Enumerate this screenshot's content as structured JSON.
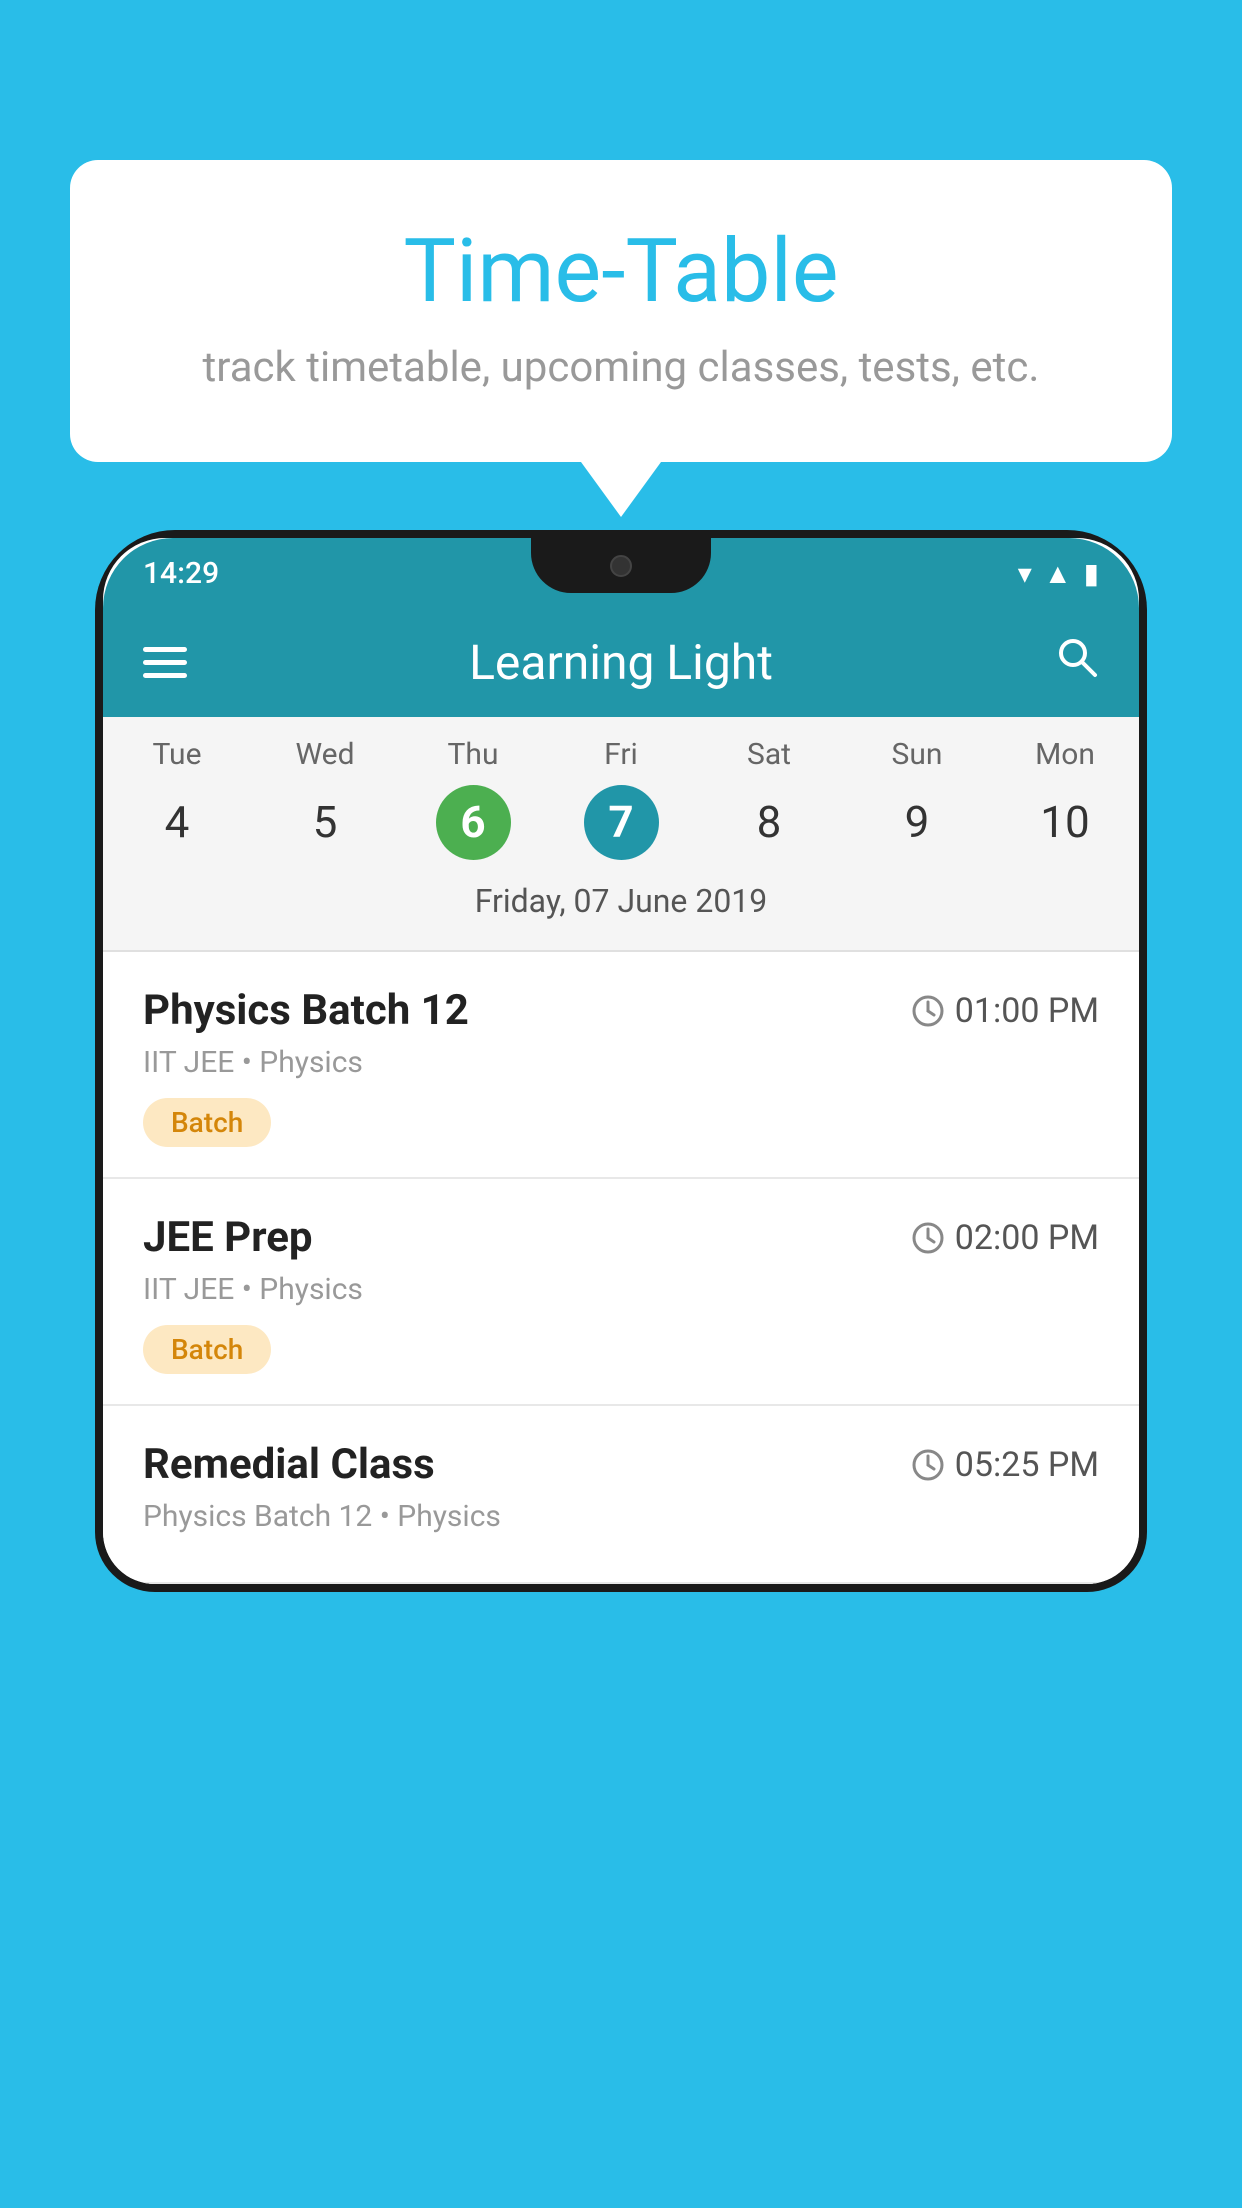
{
  "background_color": "#29bde8",
  "speech_bubble": {
    "title": "Time-Table",
    "subtitle": "track timetable, upcoming classes, tests, etc."
  },
  "app": {
    "title": "Learning Light",
    "status_time": "14:29"
  },
  "calendar": {
    "days": [
      {
        "label": "Tue",
        "number": "4",
        "state": "normal"
      },
      {
        "label": "Wed",
        "number": "5",
        "state": "normal"
      },
      {
        "label": "Thu",
        "number": "6",
        "state": "today"
      },
      {
        "label": "Fri",
        "number": "7",
        "state": "selected"
      },
      {
        "label": "Sat",
        "number": "8",
        "state": "normal"
      },
      {
        "label": "Sun",
        "number": "9",
        "state": "normal"
      },
      {
        "label": "Mon",
        "number": "10",
        "state": "normal"
      }
    ],
    "selected_date_label": "Friday, 07 June 2019"
  },
  "schedule_items": [
    {
      "name": "Physics Batch 12",
      "time": "01:00 PM",
      "meta": "IIT JEE • Physics",
      "tag": "Batch"
    },
    {
      "name": "JEE Prep",
      "time": "02:00 PM",
      "meta": "IIT JEE • Physics",
      "tag": "Batch"
    },
    {
      "name": "Remedial Class",
      "time": "05:25 PM",
      "meta": "Physics Batch 12 • Physics",
      "tag": ""
    }
  ],
  "icons": {
    "hamburger": "☰",
    "search": "🔍",
    "clock": "🕐"
  }
}
